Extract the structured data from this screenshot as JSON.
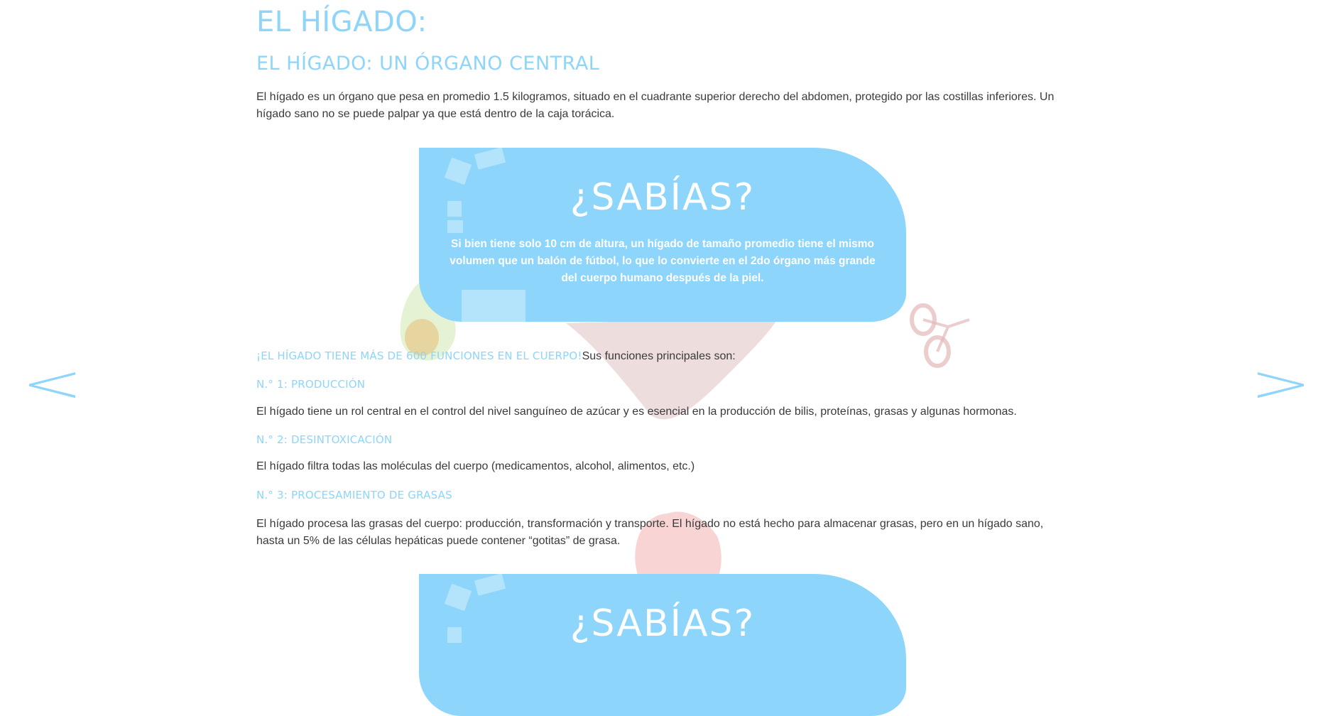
{
  "nav": {
    "prev_label": "<",
    "next_label": ">"
  },
  "article": {
    "title": "EL HÍGADO:",
    "subtitle": "EL HÍGADO: UN ÓRGANO CENTRAL",
    "intro": "El hígado es un órgano que pesa en promedio 1.5 kilogramos, situado en el cuadrante superior derecho del abdomen, protegido por las costillas inferiores. Un hígado sano no se puede palpar ya que está dentro de la caja torácica.",
    "callout": {
      "title": "¿SABÍAS?",
      "text": "Si bien tiene solo 10 cm de altura, un hígado de tamaño promedio tiene el mismo volumen que un balón de fútbol, lo que lo convierte en el 2do órgano más grande del cuerpo humano después de la piel."
    },
    "functions_heading": "¡EL HÍGADO TIENE MÁS DE 600 FUNCIONES EN EL CUERPO!",
    "functions_intro": "Sus funciones principales son:",
    "functions": [
      {
        "title": "N.° 1: PRODUCCIÓN",
        "text": "El hígado tiene un rol central en el control del nivel sanguíneo de azúcar y es esencial en la producción de bilis, proteínas, grasas y algunas hormonas."
      },
      {
        "title": "N.° 2: DESINTOXICACIÓN",
        "text": "El hígado filtra todas las moléculas del cuerpo (medicamentos, alcohol, alimentos, etc.)"
      },
      {
        "title": "N.° 3: PROCESAMIENTO DE GRASAS",
        "text": "El hígado procesa las grasas del cuerpo: producción, transformación y transporte. El hígado no está hecho para almacenar grasas, pero en un hígado sano, hasta un 5% de las células hepáticas puede contener “gotitas” de grasa."
      }
    ],
    "callout_2": {
      "title": "¿SABÍAS?"
    }
  },
  "colors": {
    "accent": "#8dd5fb",
    "text": "#3a3a3a"
  },
  "decorations": [
    "avocado-illustration",
    "liver-illustration",
    "bicycle-illustration",
    "apple-illustration"
  ]
}
